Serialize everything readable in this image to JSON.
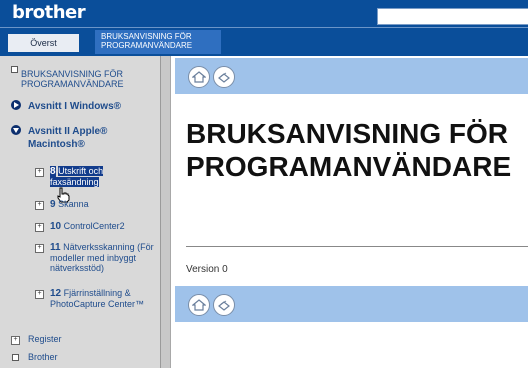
{
  "header": {
    "logo": "brother",
    "tabs": [
      {
        "label": "Överst"
      },
      {
        "label": "BRUKSANVISNING FÖR PROGRAMANVÄNDARE"
      }
    ]
  },
  "sidebar": {
    "top_item": "BRUKSANVISNING FÖR PROGRAMANVÄNDARE",
    "section1": "Avsnitt I Windows®",
    "section2": "Avsnitt II Apple® Macintosh®",
    "items": [
      {
        "num": "8",
        "label": "Utskrift och faxsändning"
      },
      {
        "num": "9",
        "label": "Skanna"
      },
      {
        "num": "10",
        "label": "ControlCenter2"
      },
      {
        "num": "11",
        "label": "Nätverksskanning (För modeller med inbyggt nätverksstöd)"
      },
      {
        "num": "12",
        "label": "Fjärrinställning & PhotoCapture Center™"
      }
    ],
    "register": "Register",
    "brother": "Brother"
  },
  "content": {
    "title": "BRUKSANVISNING FÖR PROGRAMANVÄNDARE",
    "version": "Version 0"
  },
  "colors": {
    "header": "#0a4e9a",
    "tab_active": "#2f6fc0",
    "bar": "#9fc2ea",
    "sidebar": "#d9d9d9",
    "highlight": "#123c8c"
  },
  "icons": [
    "home-icon",
    "print-icon",
    "expand-icon",
    "arrow-right-icon",
    "arrow-down-icon",
    "hand-cursor-icon"
  ]
}
